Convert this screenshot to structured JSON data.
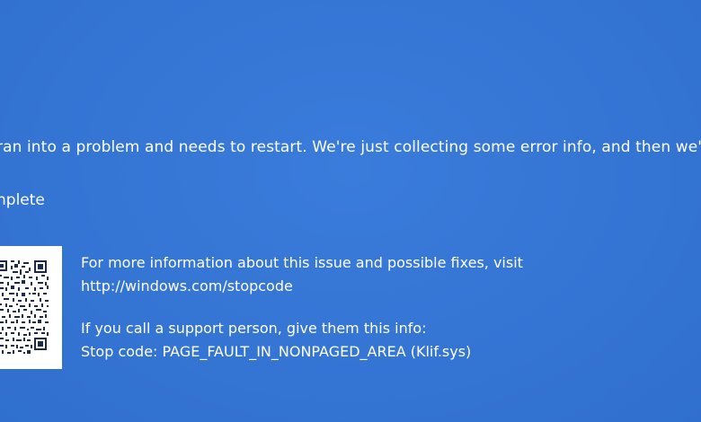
{
  "screen": {
    "background_color": "#3677d6",
    "text_color": "#ffffff",
    "message": "ran into a problem and needs to restart. We're just collecting some error info, and then we'll resta",
    "progress_text": "nplete"
  },
  "qr": {
    "icon": "qr-code-icon"
  },
  "info": {
    "more_info_line": "For more information about this issue and possible fixes, visit",
    "url": "http://windows.com/stopcode",
    "support_line": "If you call a support person, give them this info:",
    "stop_code_line": "Stop code: PAGE_FAULT_IN_NONPAGED_AREA (Klif.sys)"
  }
}
